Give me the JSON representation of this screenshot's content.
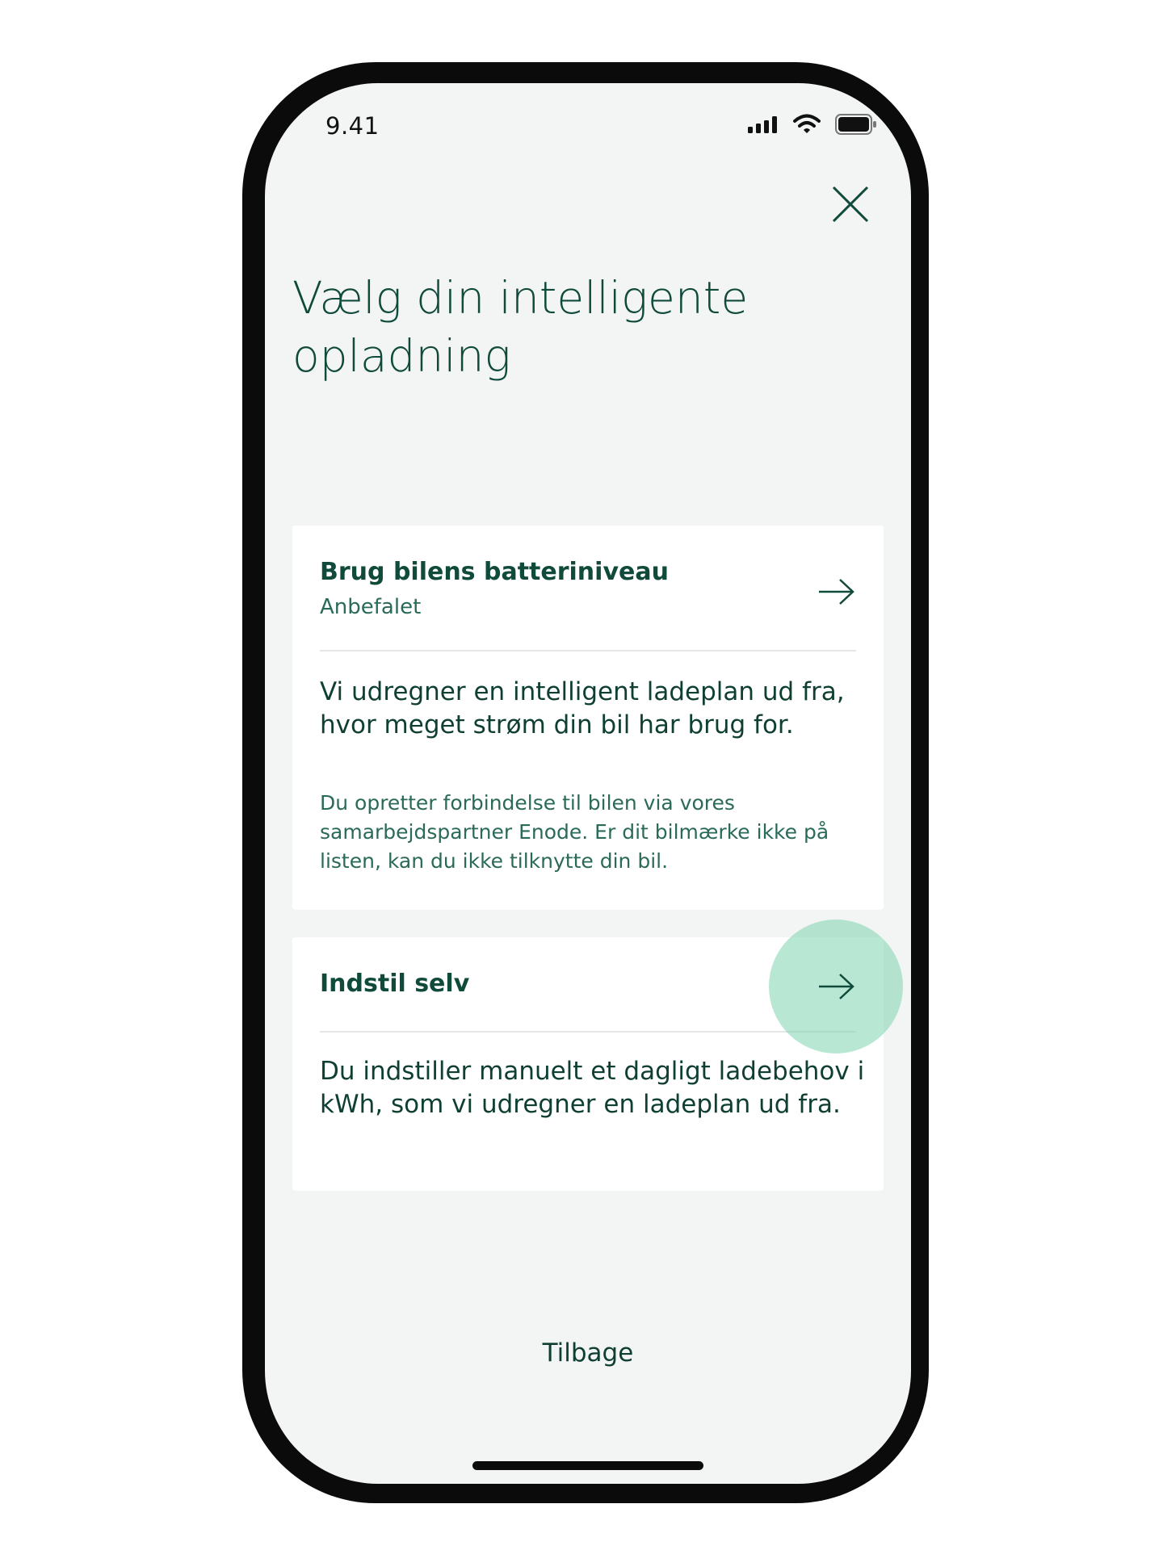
{
  "status_bar": {
    "time": "9.41",
    "icons": [
      "cellular-signal-icon",
      "wifi-icon",
      "battery-icon"
    ]
  },
  "header": {
    "close_icon": "close-icon",
    "title": "Vælg din intelligente opladning"
  },
  "options": [
    {
      "title": "Brug bilens batteriniveau",
      "subtitle": "Anbefalet",
      "description": "Vi udregner en intelligent ladeplan ud fra, hvor meget strøm din bil har brug for.",
      "note": "Du opretter forbindelse til bilen via vores samarbejdspartner Enode. Er dit bilmærke ikke på listen, kan du ikke tilknytte din bil.",
      "icon": "arrow-right-icon"
    },
    {
      "title": "Indstil selv",
      "description": "Du indstiller manuelt et dagligt ladebehov i kWh, som vi udregner en ladeplan ud fra.",
      "icon": "arrow-right-icon"
    }
  ],
  "footer": {
    "back_label": "Tilbage"
  },
  "colors": {
    "text_primary": "#0f4a3a",
    "text_secondary": "#2a6a58",
    "screen_background": "#f3f4f4",
    "card_background": "#ffffff",
    "highlight": "#7ed6af"
  }
}
